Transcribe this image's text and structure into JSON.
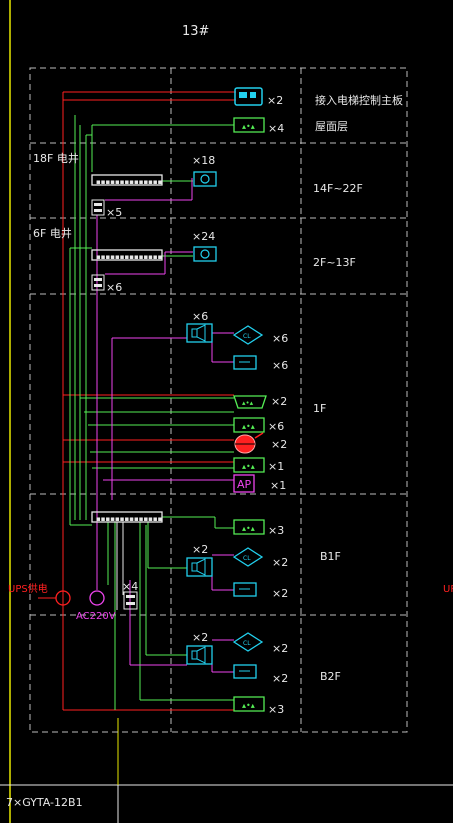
{
  "title": "13#",
  "zones": {
    "roof_label": "接入电梯控制主板",
    "roof_sub": "屋面层",
    "z14": "14F~22F",
    "z2": "2F~13F",
    "z1": "1F",
    "zb1": "B1F",
    "zb2": "B2F"
  },
  "shafts": {
    "s18": "18F 电井",
    "s6": "6F 电井"
  },
  "counts": {
    "c_x2_top": "×2",
    "c_x4_top": "×4",
    "c_x18": "×18",
    "c_x5": "×5",
    "c_x24": "×24",
    "c_x6_sw": "×6",
    "c_x6_cam": "×6",
    "c_x6a": "×6",
    "c_x6b": "×6",
    "c_x2_1f": "×2",
    "c_x6_1f": "×6",
    "c_x2_alarm": "×2",
    "c_x1_a": "×1",
    "c_x1_ap": "×1",
    "c_x3_b1": "×3",
    "c_x2_b1cam": "×2",
    "c_x2_b1a": "×2",
    "c_x2_b1b": "×2",
    "c_x4_b": "×4",
    "c_x2_b2cam": "×2",
    "c_x2_b2a": "×2",
    "c_x2_b2b": "×2",
    "c_x3_b2": "×3"
  },
  "ap_label": "AP",
  "power": {
    "ups_left": "UPS供电",
    "ups_right": "UP",
    "ac": "AC220V"
  },
  "cable": "7×GYTA-12B1",
  "colors": {
    "red": "#ff2020",
    "green": "#55ee55",
    "magenta": "#ee44ee",
    "cyan": "#22d0ee",
    "grid": "#bdbdbd",
    "yellow": "#e8e800"
  }
}
